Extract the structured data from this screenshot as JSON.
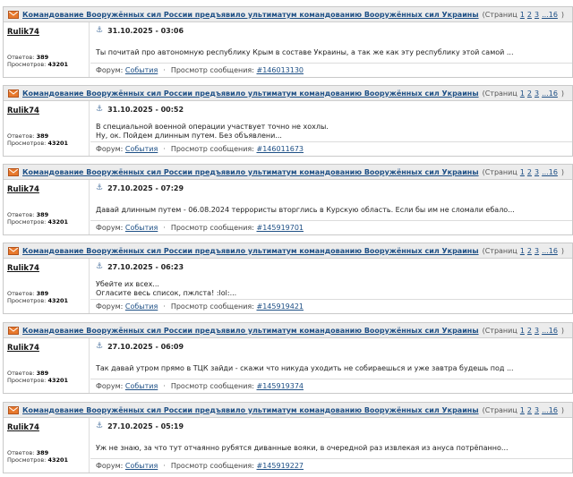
{
  "topic_title": "Командование Вооружённых сил России предъявило ультиматум командованию Вооружённых сил Украины",
  "pages_prefix": "(Страниц",
  "page_links": [
    "1",
    "2",
    "3",
    "...16",
    ")"
  ],
  "author_name": "Rulik74",
  "stats": {
    "answers_label": "Ответов:",
    "answers": "389",
    "views_label": "Просмотров:",
    "views": "43201"
  },
  "meta": {
    "forum_label": "Форум:",
    "forum_link": "События",
    "separator": "·",
    "view_label": "Просмотр сообщения:"
  },
  "icons": {
    "header": "mail-icon",
    "date": "anchor-icon"
  },
  "colors": {
    "link": "#1d4f85",
    "header_bg": "#ececec",
    "icon": "#e8792d"
  },
  "posts": [
    {
      "date": "31.10.2025 - 03:06",
      "message_lines": [
        "Ты почитай про автономную республику Крым в составе Украины, а так же как эту республику этой самой ..."
      ],
      "message_id": "#146013130"
    },
    {
      "date": "31.10.2025 - 00:52",
      "message_lines": [
        "В специальной военной операции участвует точно не хохлы.",
        "Ну, ок. Пойдем длинным путем. Без объявлени..."
      ],
      "message_id": "#146011673"
    },
    {
      "date": "27.10.2025 - 07:29",
      "message_lines": [
        "Давай длинным путем - 06.08.2024 террористы вторглись в Курскую область. Если бы им не сломали ебало..."
      ],
      "message_id": "#145919701"
    },
    {
      "date": "27.10.2025 - 06:23",
      "message_lines": [
        "Убейте их всех...",
        "Огласите весь список, пжлста! :lol:..."
      ],
      "message_id": "#145919421"
    },
    {
      "date": "27.10.2025 - 06:09",
      "message_lines": [
        "Так давай утром прямо в ТЦК зайди - скажи что никуда уходить не собираешься и уже завтра будешь под ..."
      ],
      "message_id": "#145919374"
    },
    {
      "date": "27.10.2025 - 05:19",
      "message_lines": [
        "Уж не знаю, за что тут отчаянно рубятся диванные вояки, в очередной раз извлекая из ануса потрёпанно..."
      ],
      "message_id": "#145919227"
    }
  ]
}
